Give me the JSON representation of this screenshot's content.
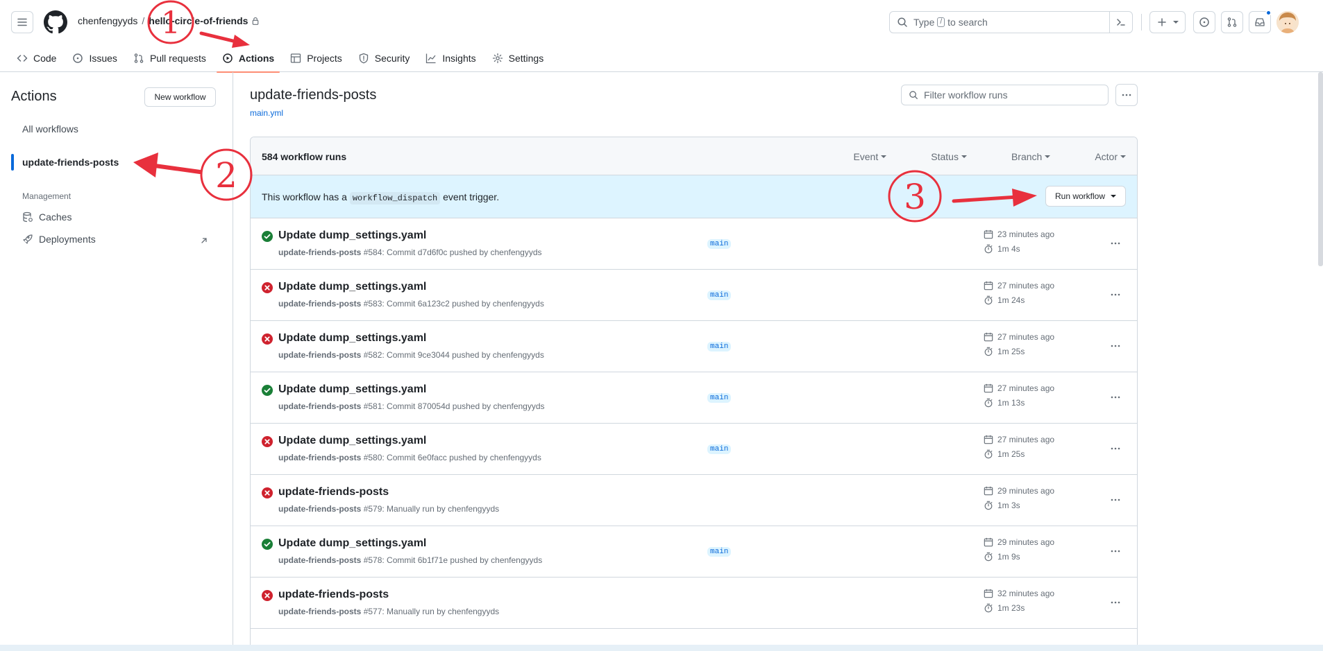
{
  "header": {
    "owner": "chenfengyyds",
    "separator": "/",
    "repo": "hello-circle-of-friends",
    "search_prefix": "Type",
    "search_key": "/",
    "search_suffix": "to search"
  },
  "repo_nav": [
    {
      "label": "Code",
      "icon": "code-icon"
    },
    {
      "label": "Issues",
      "icon": "issue-icon"
    },
    {
      "label": "Pull requests",
      "icon": "pull-request-icon"
    },
    {
      "label": "Actions",
      "icon": "play-icon",
      "active": true
    },
    {
      "label": "Projects",
      "icon": "table-icon"
    },
    {
      "label": "Security",
      "icon": "shield-icon"
    },
    {
      "label": "Insights",
      "icon": "graph-icon"
    },
    {
      "label": "Settings",
      "icon": "gear-icon"
    }
  ],
  "sidebar": {
    "title": "Actions",
    "new_workflow": "New workflow",
    "all_workflows": "All workflows",
    "active_workflow": "update-friends-posts",
    "management_label": "Management",
    "caches": "Caches",
    "deployments": "Deployments"
  },
  "main": {
    "title": "update-friends-posts",
    "file": "main.yml",
    "filter_placeholder": "Filter workflow runs",
    "run_count": "584 workflow runs",
    "filters": [
      "Event",
      "Status",
      "Branch",
      "Actor"
    ],
    "dispatch_pre": "This workflow has a",
    "dispatch_code": "workflow_dispatch",
    "dispatch_post": "event trigger.",
    "run_workflow": "Run workflow"
  },
  "runs": [
    {
      "status": "success",
      "title": "Update dump_settings.yaml",
      "workflow": "update-friends-posts",
      "meta": "#584: Commit d7d6f0c pushed by chenfengyyds",
      "branch": "main",
      "when": "23 minutes ago",
      "duration": "1m 4s"
    },
    {
      "status": "failure",
      "title": "Update dump_settings.yaml",
      "workflow": "update-friends-posts",
      "meta": "#583: Commit 6a123c2 pushed by chenfengyyds",
      "branch": "main",
      "when": "27 minutes ago",
      "duration": "1m 24s"
    },
    {
      "status": "failure",
      "title": "Update dump_settings.yaml",
      "workflow": "update-friends-posts",
      "meta": "#582: Commit 9ce3044 pushed by chenfengyyds",
      "branch": "main",
      "when": "27 minutes ago",
      "duration": "1m 25s"
    },
    {
      "status": "success",
      "title": "Update dump_settings.yaml",
      "workflow": "update-friends-posts",
      "meta": "#581: Commit 870054d pushed by chenfengyyds",
      "branch": "main",
      "when": "27 minutes ago",
      "duration": "1m 13s"
    },
    {
      "status": "failure",
      "title": "Update dump_settings.yaml",
      "workflow": "update-friends-posts",
      "meta": "#580: Commit 6e0facc pushed by chenfengyyds",
      "branch": "main",
      "when": "27 minutes ago",
      "duration": "1m 25s"
    },
    {
      "status": "failure",
      "title": "update-friends-posts",
      "workflow": "update-friends-posts",
      "meta": "#579: Manually run by chenfengyyds",
      "branch": "",
      "when": "29 minutes ago",
      "duration": "1m 3s"
    },
    {
      "status": "success",
      "title": "Update dump_settings.yaml",
      "workflow": "update-friends-posts",
      "meta": "#578: Commit 6b1f71e pushed by chenfengyyds",
      "branch": "main",
      "when": "29 minutes ago",
      "duration": "1m 9s"
    },
    {
      "status": "failure",
      "title": "update-friends-posts",
      "workflow": "update-friends-posts",
      "meta": "#577: Manually run by chenfengyyds",
      "branch": "",
      "when": "32 minutes ago",
      "duration": "1m 23s"
    }
  ],
  "annotations": [
    "1",
    "2",
    "3"
  ],
  "colors": {
    "success": "#1a7f37",
    "failure": "#cf222e",
    "accent": "#0969da",
    "annotation": "#e8303d"
  }
}
